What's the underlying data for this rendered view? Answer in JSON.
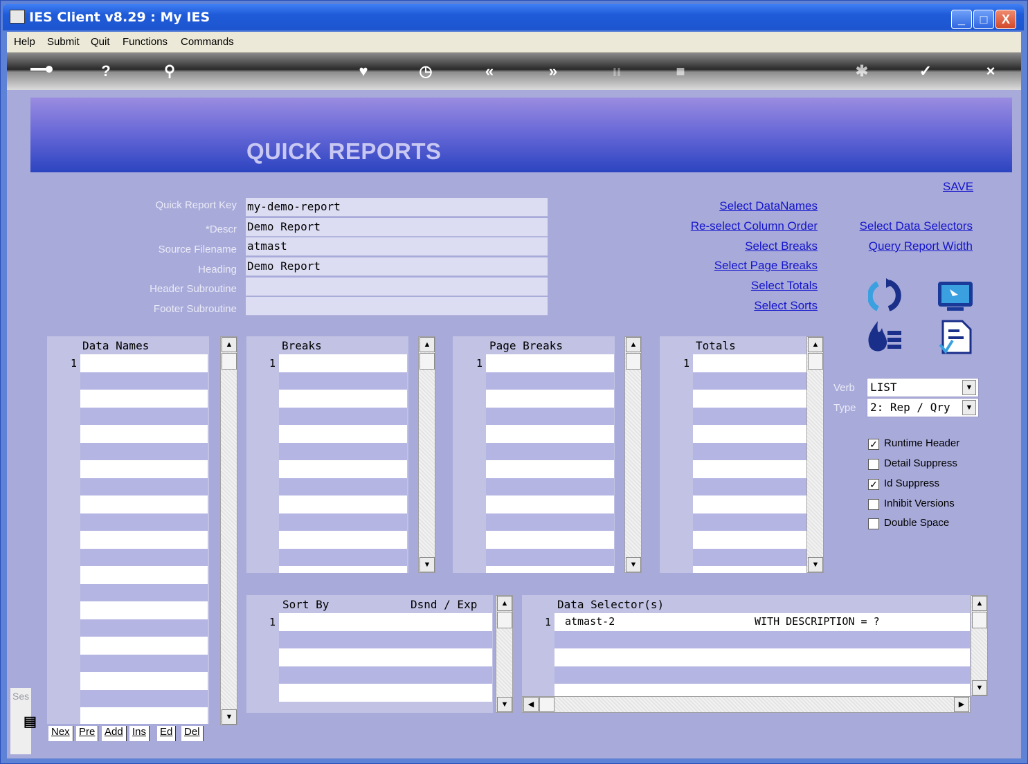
{
  "window": {
    "title": "IES Client v8.29 : My IES",
    "minimize": "_",
    "maximize": "□",
    "close": "X"
  },
  "menu": [
    "Help",
    "Submit",
    "Quit",
    "Functions",
    "Commands"
  ],
  "toolbar": {
    "icons": [
      "key-icon",
      "help-icon",
      "search-icon",
      "heart-icon",
      "clock-icon",
      "rewind-icon",
      "forward-icon",
      "tree-icon",
      "stop-icon",
      "cancel-icon",
      "check-icon",
      "close-icon"
    ],
    "glyphs": {
      "help": "?",
      "search": "⚲",
      "heart": "♥",
      "clock": "◷",
      "rewind": "«",
      "forward": "»",
      "check": "✓",
      "close": "×"
    }
  },
  "page": {
    "title": "QUICK REPORTS",
    "save": "SAVE"
  },
  "form": {
    "fields": [
      {
        "label": "Quick Report Key",
        "value": "my-demo-report"
      },
      {
        "label": "*Descr",
        "value": "Demo Report"
      },
      {
        "label": "Source Filename",
        "value": "atmast"
      },
      {
        "label": "Heading",
        "value": "Demo Report"
      },
      {
        "label": "Header Subroutine",
        "value": ""
      },
      {
        "label": "Footer Subroutine",
        "value": ""
      }
    ]
  },
  "links": {
    "select_datanames": "Select DataNames",
    "reselect_column_order": "Re-select Column Order",
    "select_breaks": "Select Breaks",
    "select_page_breaks": "Select Page Breaks",
    "select_totals": "Select Totals",
    "select_sorts": "Select Sorts",
    "select_data_selectors": "Select Data Selectors",
    "query_report_width": "Query Report Width"
  },
  "lists": {
    "data_names": {
      "header": "Data Names",
      "first_row": "1"
    },
    "breaks": {
      "header": "Breaks",
      "first_row": "1"
    },
    "page_breaks": {
      "header": "Page Breaks",
      "first_row": "1"
    },
    "totals": {
      "header": "Totals",
      "first_row": "1"
    },
    "sort_by": {
      "header": "Sort By",
      "header2": "Dsnd / Exp",
      "first_row": "1"
    },
    "data_selectors": {
      "header": "Data Selector(s)",
      "first_row": "1",
      "row1_name": "atmast-2",
      "row1_expr": "WITH DESCRIPTION = ?"
    }
  },
  "options": {
    "verb_label": "Verb",
    "verb_value": "LIST",
    "type_label": "Type",
    "type_value": "2: Rep / Qry",
    "checkboxes": [
      {
        "label": "Runtime Header",
        "checked": true
      },
      {
        "label": "Detail Suppress",
        "checked": false
      },
      {
        "label": "Id Suppress",
        "checked": true
      },
      {
        "label": "Inhibit Versions",
        "checked": false
      },
      {
        "label": "Double Space",
        "checked": false
      }
    ],
    "check_mark": "✓"
  },
  "list_buttons": [
    "Nex",
    "Pre",
    "Add",
    "Ins",
    "Ed",
    "Del"
  ],
  "side_stub": "Ses"
}
